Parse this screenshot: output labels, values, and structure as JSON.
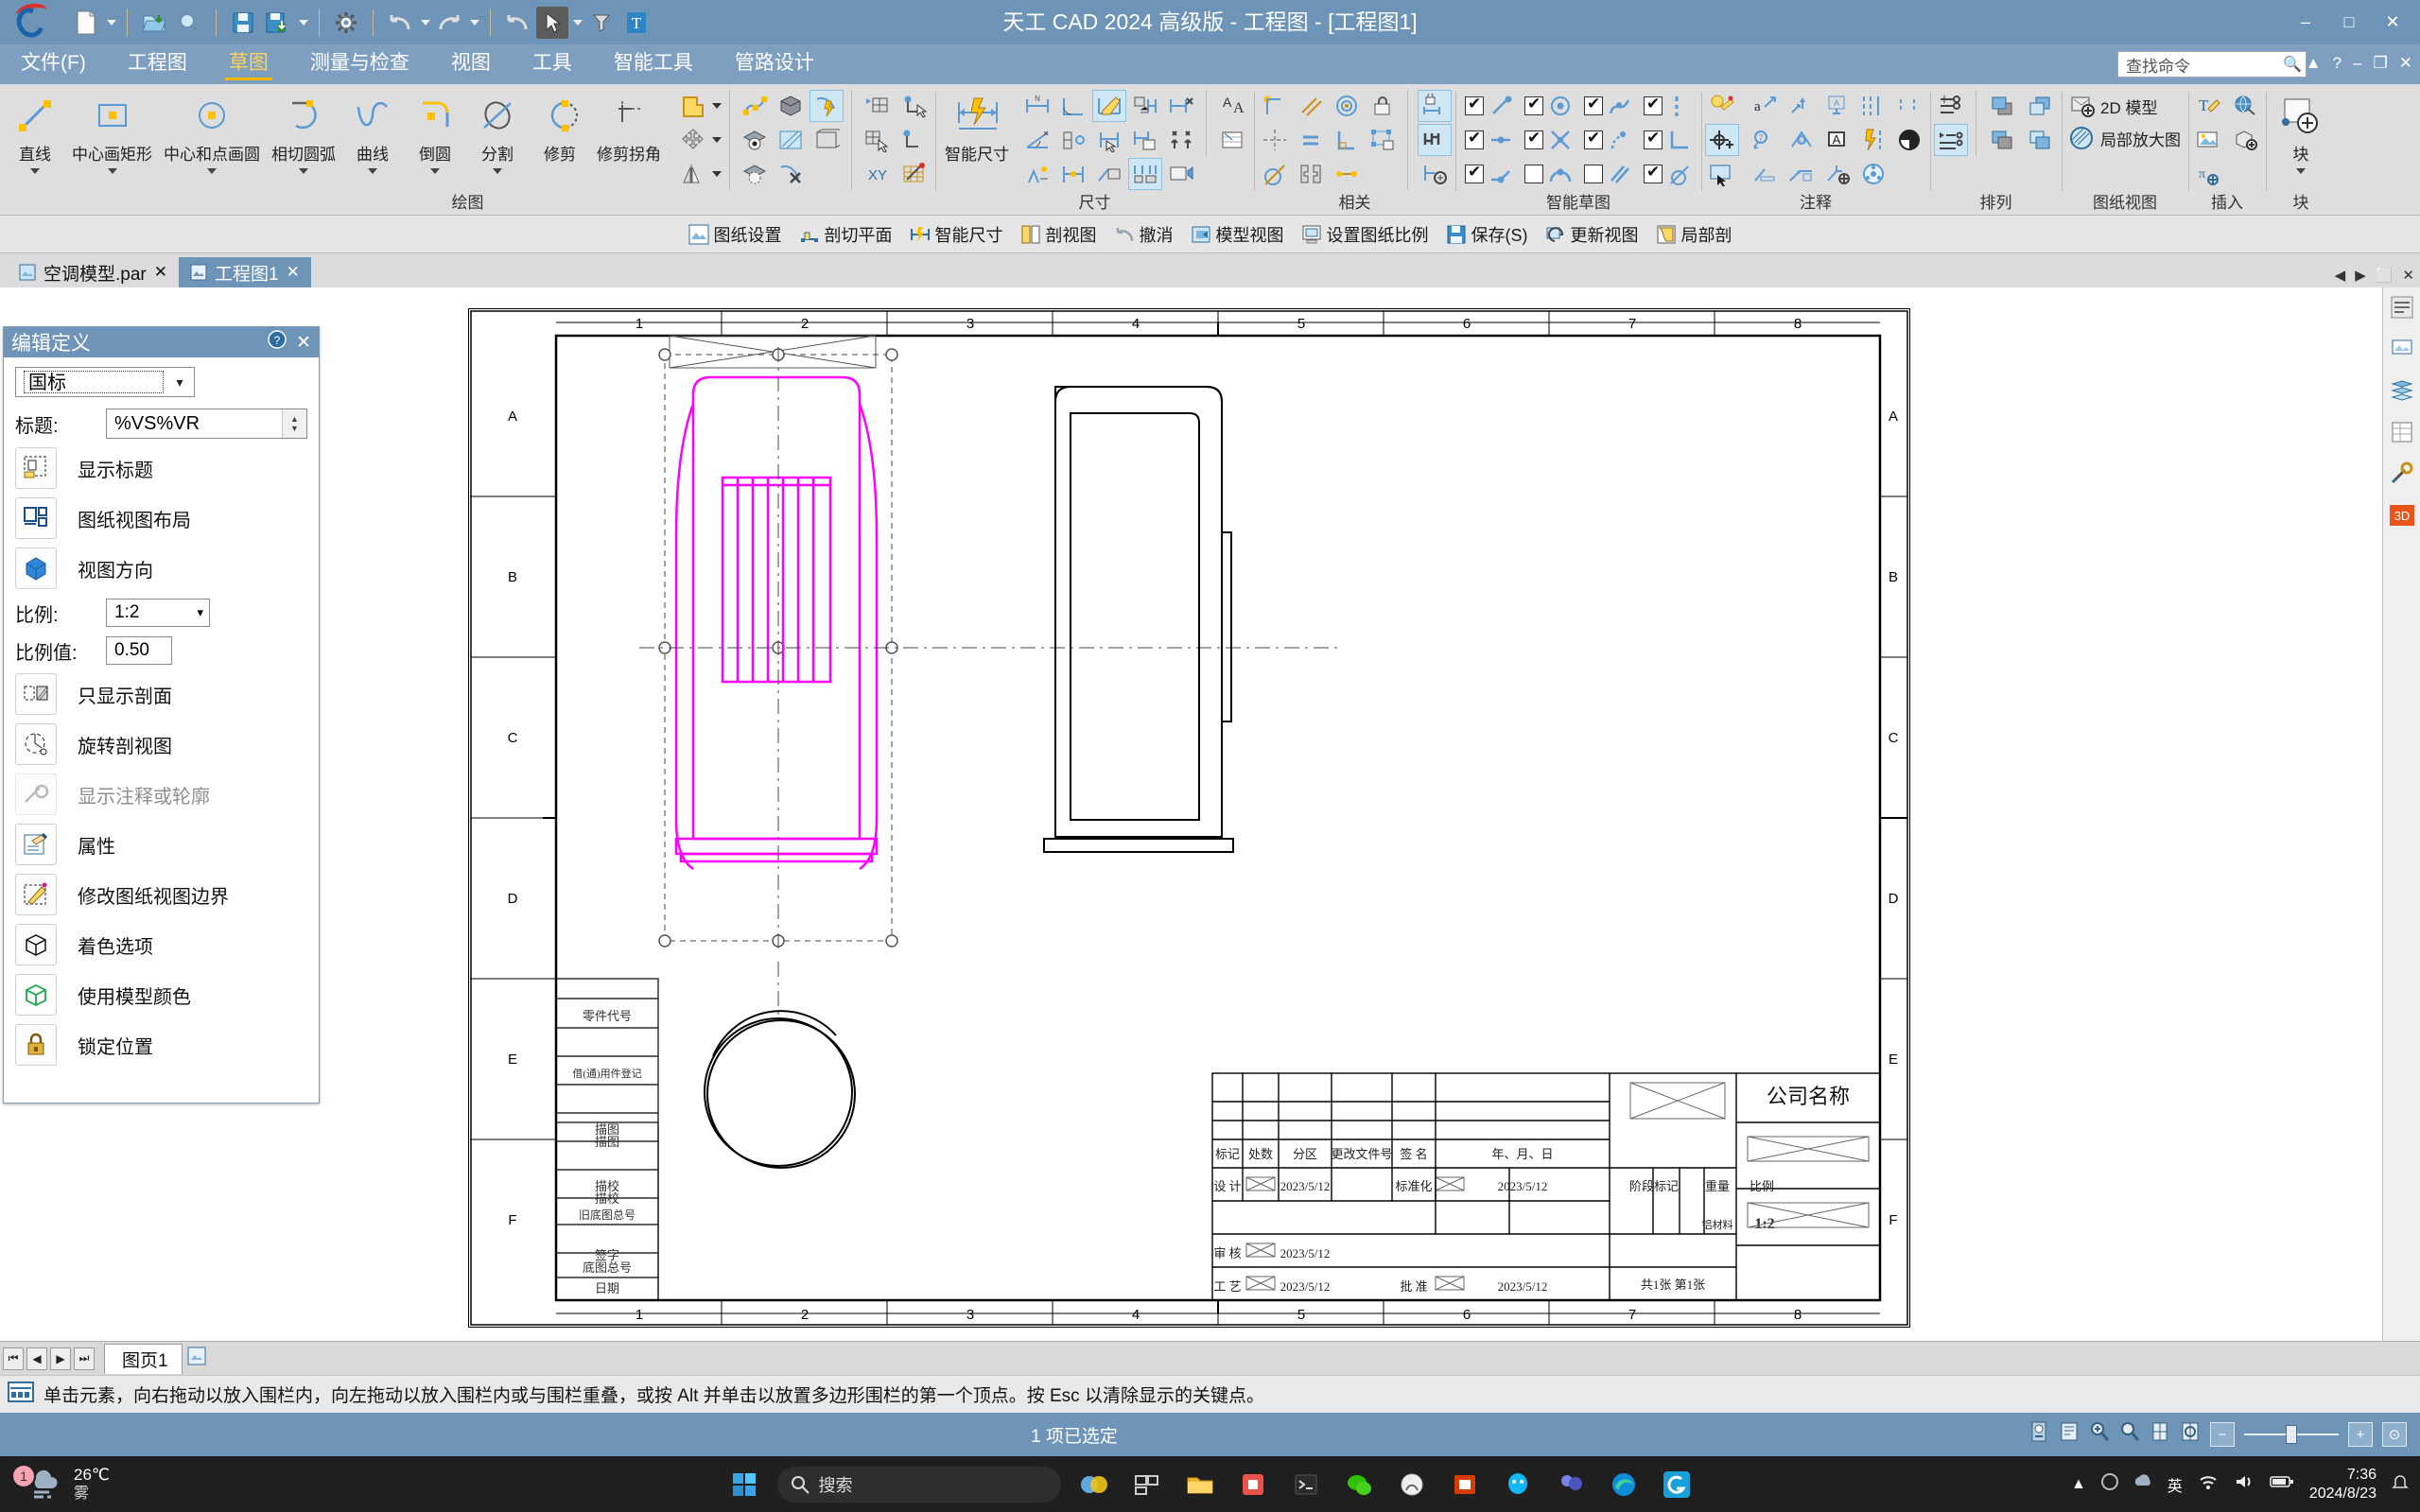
{
  "window": {
    "title": "天工 CAD 2024 高级版 - 工程图 - [工程图1]",
    "minimize": "–",
    "maximize": "□",
    "close": "✕"
  },
  "quick_access": {
    "items": [
      {
        "name": "new-file",
        "icon": "page-icon"
      },
      {
        "name": "open-file",
        "icon": "folder-open-icon"
      },
      {
        "name": "preview",
        "icon": "magnifier-icon"
      },
      {
        "name": "save",
        "icon": "floppy-icon"
      },
      {
        "name": "save-as",
        "icon": "floppy-export-icon"
      },
      {
        "name": "settings",
        "icon": "gear-icon"
      },
      {
        "name": "undo",
        "icon": "undo-arrow-icon"
      },
      {
        "name": "redo",
        "icon": "redo-arrow-icon"
      },
      {
        "name": "undo-all",
        "icon": "undo-all-icon"
      },
      {
        "name": "select-tool",
        "icon": "cursor-arrow-icon"
      },
      {
        "name": "text-tool",
        "icon": "text-T-icon"
      }
    ]
  },
  "menu": {
    "items": [
      {
        "label": "文件(F)",
        "active": false
      },
      {
        "label": "工程图",
        "active": false
      },
      {
        "label": "草图",
        "active": true
      },
      {
        "label": "测量与检查",
        "active": false
      },
      {
        "label": "视图",
        "active": false
      },
      {
        "label": "工具",
        "active": false
      },
      {
        "label": "智能工具",
        "active": false
      },
      {
        "label": "管路设计",
        "active": false
      }
    ],
    "find_placeholder": "查找命令",
    "help": "?",
    "minimize": "–",
    "restore": "❐",
    "close": "✕"
  },
  "ribbon": {
    "groups": [
      {
        "name": "绘图",
        "big_buttons": [
          {
            "label": "直线",
            "icon": "line-icon",
            "dropdown": true
          },
          {
            "label": "中心画矩形",
            "icon": "rectangle-center-icon",
            "dropdown": true
          },
          {
            "label": "中心和点画圆",
            "icon": "circle-center-point-icon",
            "dropdown": true
          },
          {
            "label": "相切圆弧",
            "icon": "tangent-arc-icon",
            "dropdown": true
          },
          {
            "label": "曲线",
            "icon": "curve-icon",
            "dropdown": true
          },
          {
            "label": "倒圆",
            "icon": "fillet-icon",
            "dropdown": true
          },
          {
            "label": "分割",
            "icon": "split-icon",
            "dropdown": true
          },
          {
            "label": "修剪",
            "icon": "trim-icon",
            "dropdown": false
          },
          {
            "label": "修剪拐角",
            "icon": "trim-corner-icon",
            "dropdown": false
          }
        ],
        "small_icons": [
          "region-icon",
          "move-icon",
          "mirror-icon",
          "edit-points-icon",
          "solid-view-icon",
          "smart-dim-view-icon",
          "view-eye-icon",
          "hatch-icon",
          "view-box-icon",
          "view-hidden-icon",
          "view-delete-icon"
        ]
      },
      {
        "name": "尺寸",
        "big_buttons": [
          {
            "label": "智能尺寸",
            "icon": "smart-dimension-icon",
            "dropdown": false
          }
        ],
        "small_icons": [
          "distance-between-icon",
          "angle-between-icon",
          "dimension-axis-icon",
          "coordinate-dim-icon",
          "dim-edit-icon",
          "dim-prefix-icon",
          "symmetric-diameter-icon",
          "chamfer-dim-icon",
          "dim-arrange-icon",
          "dim-align-icon",
          "dim-copy-icon",
          "dim-style-icon",
          "dim-remove-icon",
          "dim-updown-icon",
          "dim-table-icon"
        ]
      },
      {
        "name": "相关",
        "small_icons": [
          "connect-icon",
          "parallel-icon",
          "concentric-icon",
          "lock-icon",
          "symmetric-icon",
          "equal-icon",
          "perpendicular-icon",
          "rigid-set-icon",
          "tangent-icon",
          "mirror-constraint-icon",
          "collinear-icon",
          "lock-dim-icon",
          "relationship-handles-icon",
          "auto-dim-icon"
        ]
      },
      {
        "name": "智能草图",
        "checkboxes": [
          {
            "label": "端点",
            "icon": "endpoint-icon",
            "checked": true
          },
          {
            "label": "中点",
            "icon": "midpoint-icon",
            "checked": true
          },
          {
            "label": "点上",
            "icon": "point-on-icon",
            "checked": true
          },
          {
            "label": "圆心",
            "icon": "center-icon",
            "checked": true
          },
          {
            "label": "交点",
            "icon": "intersection-icon",
            "checked": true
          },
          {
            "label": "切点",
            "icon": "tangent-point-icon",
            "checked": true
          },
          {
            "label": "轮廓",
            "icon": "silhouette-icon",
            "checked": true
          },
          {
            "label": "水平垂直",
            "icon": "horizontal-vertical-icon",
            "checked": true
          },
          {
            "label": "边中点",
            "icon": "edge-mid-icon",
            "checked": true
          },
          {
            "label": "圆弧中点",
            "icon": "arc-mid-icon",
            "checked": false
          },
          {
            "label": "平行",
            "icon": "parallel2-icon",
            "checked": false
          },
          {
            "label": "相切",
            "icon": "tangent2-icon",
            "checked": true
          }
        ]
      },
      {
        "name": "注释",
        "small_icons": [
          "quick-annotation-icon",
          "add-point-icon",
          "select-region-icon",
          "leader-text-icon",
          "balloon-icon",
          "datum-frame-icon",
          "callout-icon",
          "centerline-icon",
          "center-mark-icon",
          "surface-finish-icon",
          "weld-symbol-icon",
          "feature-control-icon",
          "text-box-icon",
          "datum-target-icon",
          "edge-condition-icon",
          "table-icon",
          "auto-balloon-icon",
          "quick-sheet-icon",
          "hole-table-icon"
        ]
      },
      {
        "name": "排列",
        "small_icons": [
          "bring-front-icon",
          "bring-forward-icon",
          "send-back-icon",
          "send-backward-icon"
        ]
      },
      {
        "name": "图纸视图",
        "wide_items": [
          {
            "label": "2D 模型",
            "icon": "2d-model-icon"
          },
          {
            "label": "局部放大图",
            "icon": "detail-view-icon"
          }
        ]
      },
      {
        "name": "插入",
        "small_icons": [
          "insert-text-icon",
          "insert-globe-icon",
          "insert-image-icon",
          "insert-part-icon",
          "insert-variable-icon"
        ]
      },
      {
        "name": "块",
        "big_buttons": [
          {
            "label": "块",
            "icon": "block-icon",
            "dropdown": true
          }
        ]
      }
    ]
  },
  "quick_bar": {
    "items": [
      {
        "label": "图纸设置",
        "icon": "sheet-setup-icon"
      },
      {
        "label": "剖切平面",
        "icon": "cutting-plane-icon"
      },
      {
        "label": "智能尺寸",
        "icon": "smart-dim-icon"
      },
      {
        "label": "剖视图",
        "icon": "section-view-icon"
      },
      {
        "label": "撤消",
        "icon": "undo-icon"
      },
      {
        "label": "模型视图",
        "icon": "model-view-icon"
      },
      {
        "label": "设置图纸比例",
        "icon": "sheet-scale-icon"
      },
      {
        "label": "保存(S)",
        "icon": "save-icon"
      },
      {
        "label": "更新视图",
        "icon": "refresh-view-icon"
      },
      {
        "label": "局部剖",
        "icon": "broken-out-section-icon"
      }
    ]
  },
  "document_tabs": {
    "tabs": [
      {
        "label": "空调模型.par",
        "active": false,
        "close": "✕"
      },
      {
        "label": "工程图1",
        "active": true,
        "close": "✕"
      }
    ],
    "nav": [
      "◀",
      "▶",
      "⬜",
      "✕"
    ]
  },
  "panel": {
    "title": "编辑定义",
    "help_icon": "help-circle-icon",
    "close_icon": "close-icon",
    "standard": "国标",
    "title_label": "标题:",
    "title_value": "%VS%VR",
    "buttons": [
      {
        "label": "显示标题",
        "icon": "show-caption-icon"
      },
      {
        "label": "图纸视图布局",
        "icon": "drawing-view-layout-icon"
      },
      {
        "label": "视图方向",
        "icon": "view-orientation-icon"
      }
    ],
    "scale_label": "比例:",
    "scale_value": "1:2",
    "scale_value_label": "比例值:",
    "scale_number": "0.50",
    "options": [
      {
        "label": "只显示剖面",
        "icon": "show-section-only-icon"
      },
      {
        "label": "旋转剖视图",
        "icon": "rotate-section-icon"
      },
      {
        "label": "显示注释或轮廓",
        "icon": "show-annotation-icon"
      },
      {
        "label": "属性",
        "icon": "properties-icon"
      },
      {
        "label": "修改图纸视图边界",
        "icon": "edit-view-boundary-icon"
      },
      {
        "label": "着色选项",
        "icon": "shading-options-icon"
      },
      {
        "label": "使用模型颜色",
        "icon": "use-model-color-icon"
      },
      {
        "label": "锁定位置",
        "icon": "lock-position-icon"
      }
    ]
  },
  "drawing": {
    "column_labels_top": [
      "1",
      "2",
      "3",
      "4",
      "5",
      "6",
      "7",
      "8"
    ],
    "row_labels": [
      "A",
      "B",
      "C",
      "D",
      "E",
      "F"
    ],
    "left_block_labels": [
      "零件代号",
      "借(通)用件登记",
      "描图",
      "描校",
      "旧底图总号",
      "底图总号",
      "签字",
      "日期"
    ],
    "title_block": {
      "header_row": [
        "标记",
        "处数",
        "分区",
        "更改文件号",
        "签 名",
        "年、月、日"
      ],
      "rows": [
        {
          "role": "设 计",
          "sign": "☒",
          "date": "2023/5/12",
          "role2": "标准化",
          "sign2": "☒",
          "date2": "2023/5/12"
        },
        {
          "role": "",
          "sign": "",
          "date": "",
          "role2": "",
          "sign2": "",
          "date2": ""
        },
        {
          "role": "审 核",
          "sign": "☒",
          "date": "2023/5/12",
          "role2": "",
          "sign2": "",
          "date2": ""
        },
        {
          "role": "工 艺",
          "sign": "☒",
          "date": "2023/5/12",
          "role2": "批 准",
          "sign2": "☒",
          "date2": "2023/5/12"
        }
      ],
      "stage_mark": "阶段标记",
      "weight": "重量",
      "ratio": "比例",
      "material": "铝材料",
      "ratio_value": "1:2",
      "sheets": "共1张   第1张",
      "company": "公司名称"
    }
  },
  "right_strip": {
    "items": [
      {
        "name": "pathfinder-icon"
      },
      {
        "name": "layers-icon"
      },
      {
        "name": "sheet-icon"
      },
      {
        "name": "library-icon"
      },
      {
        "name": "tools-icon"
      },
      {
        "name": "3d-icon",
        "label": "3D"
      }
    ]
  },
  "sheet_tabs": {
    "nav": [
      "⏮",
      "◀",
      "▶",
      "⏭"
    ],
    "tabs": [
      {
        "label": "图页1",
        "active": true
      }
    ],
    "add_icon": "add-sheet-icon"
  },
  "prompt": {
    "icon": "prompt-icon",
    "text": "单击元素，向右拖动以放入围栏内，向左拖动以放入围栏内或与围栏重叠，或按 Alt 并单击以放置多边形围栏的第一个顶点。按 Esc 以清除显示的关键点。"
  },
  "status": {
    "text": "1 项已选定",
    "tools": [
      "lock-view-icon",
      "fit-icon",
      "zoom-area-icon",
      "zoom-icon",
      "pan-icon",
      "rotate-icon"
    ],
    "zoom_out": "−",
    "zoom_in": "+",
    "zoom_fit": "⊙"
  },
  "taskbar": {
    "weather_temp": "26℃",
    "weather_desc": "雾",
    "weather_badge": "1",
    "search_placeholder": "搜索",
    "search_icon": "search-icon",
    "apps": [
      {
        "name": "windows-start-icon"
      },
      {
        "name": "search-box"
      },
      {
        "name": "task-view-icon"
      },
      {
        "name": "widgets-icon"
      },
      {
        "name": "file-explorer-icon"
      },
      {
        "name": "store-icon"
      },
      {
        "name": "terminal-icon"
      },
      {
        "name": "xbox-icon"
      },
      {
        "name": "wechat-icon"
      },
      {
        "name": "office-icon"
      },
      {
        "name": "qq-icon"
      },
      {
        "name": "teams-icon"
      },
      {
        "name": "edge-icon"
      },
      {
        "name": "cad-icon"
      }
    ],
    "tray_ime": "英",
    "tray_icons": [
      "chevron-up-icon",
      "ime-icon",
      "wifi-icon",
      "volume-icon",
      "battery-icon"
    ],
    "time": "7:36",
    "date": "2024/8/23",
    "notify_icon": "notification-icon"
  }
}
